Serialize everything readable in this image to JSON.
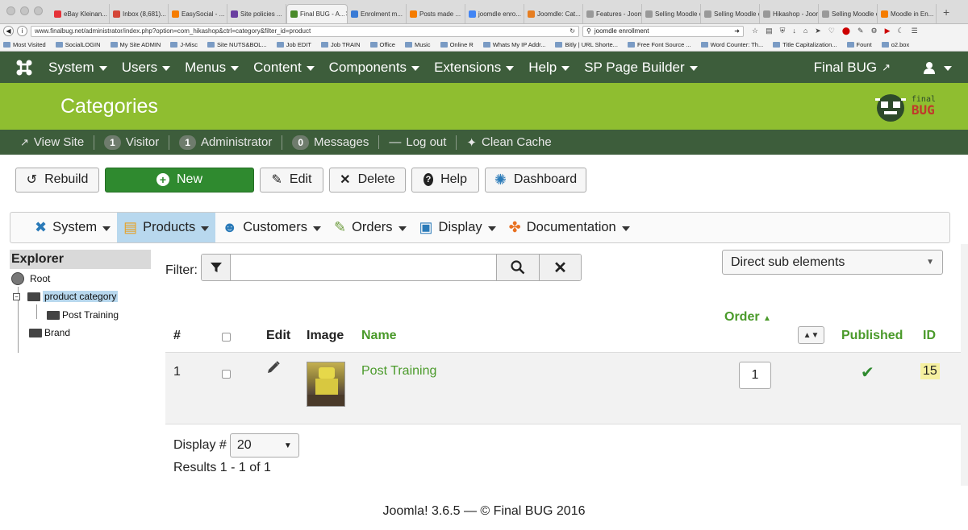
{
  "browser": {
    "tabs": [
      {
        "title": "eBay Kleinan...",
        "color": "#e53238"
      },
      {
        "title": "Inbox (8,681)...",
        "color": "#d44638"
      },
      {
        "title": "EasySocial - ...",
        "color": "#f57c00"
      },
      {
        "title": "Site policies ...",
        "color": "#6a3fa0"
      },
      {
        "title": "Final BUG - A...",
        "color": "#4a8a2a",
        "active": true
      },
      {
        "title": "Enrolment m...",
        "color": "#3a7bd5"
      },
      {
        "title": "Posts made ...",
        "color": "#f57c00"
      },
      {
        "title": "joomdle enro...",
        "color": "#4285f4"
      },
      {
        "title": "Joomdle: Cat...",
        "color": "#e67e22"
      },
      {
        "title": "Features - Joom...",
        "color": "#999999"
      },
      {
        "title": "Selling Moodle c...",
        "color": "#999999"
      },
      {
        "title": "Selling Moodle c...",
        "color": "#999999"
      },
      {
        "title": "Hikashop - Joom...",
        "color": "#999999"
      },
      {
        "title": "Selling Moodle c...",
        "color": "#999999"
      },
      {
        "title": "Moodle in En...",
        "color": "#f57c00"
      }
    ],
    "url": "www.finalbug.net/administrator/index.php?option=com_hikashop&ctrl=category&filter_id=product",
    "search": "joomdle enrollment",
    "bookmarks": [
      "Most Visited",
      "SocialLOGIN",
      "My Site ADMIN",
      "J-Misc",
      "Site NUTS&BOL...",
      "Job EDIT",
      "Job TRAIN",
      "Office",
      "Music",
      "Online R",
      "Whats My IP Addr...",
      "Bitly | URL Shorte...",
      "Free Font Source ...",
      "Word Counter: Th...",
      "Title Capitalization...",
      "Fount",
      "o2.box"
    ]
  },
  "nav": {
    "items": [
      "System",
      "Users",
      "Menus",
      "Content",
      "Components",
      "Extensions",
      "Help",
      "SP Page Builder"
    ],
    "site_name": "Final BUG"
  },
  "page": {
    "title": "Categories",
    "brand_top": "final",
    "brand_bottom": "BUG"
  },
  "status": {
    "view_site": "View Site",
    "visitor_count": "1",
    "visitor_label": "Visitor",
    "admin_count": "1",
    "admin_label": "Administrator",
    "messages_count": "0",
    "messages_label": "Messages",
    "logout": "Log out",
    "clean_cache": "Clean Cache"
  },
  "toolbar": {
    "rebuild": "Rebuild",
    "new": "New",
    "edit": "Edit",
    "delete": "Delete",
    "help": "Help",
    "dashboard": "Dashboard"
  },
  "submenu": {
    "items": [
      "System",
      "Products",
      "Customers",
      "Orders",
      "Display",
      "Documentation"
    ]
  },
  "explorer": {
    "title": "Explorer",
    "root": "Root",
    "product_category": "product category",
    "post_training": "Post Training",
    "brand": "Brand"
  },
  "filter": {
    "label": "Filter:",
    "value": "",
    "scope": "Direct sub elements"
  },
  "table": {
    "headers": {
      "num": "#",
      "edit": "Edit",
      "image": "Image",
      "name": "Name",
      "order": "Order",
      "published": "Published",
      "id": "ID"
    },
    "rows": [
      {
        "num": "1",
        "name": "Post Training",
        "order": "1",
        "id": "15"
      }
    ]
  },
  "pagination": {
    "display_label": "Display #",
    "display_value": "20",
    "results": "Results 1 - 1 of 1"
  },
  "footer": {
    "text": "Joomla! 3.6.5  —  © Final BUG 2016"
  },
  "colors": {
    "nav_bg": "#3d5d3b",
    "title_bg": "#8fbe30",
    "accent_green": "#4a9a2a",
    "new_button": "#2f8a2f"
  }
}
